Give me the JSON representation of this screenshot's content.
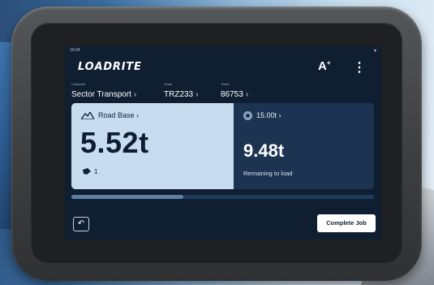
{
  "status_bar": {
    "time": "10:24"
  },
  "app_bar": {
    "logo_text": "LOADRITE",
    "font_size_label": "A",
    "font_size_sup": "+",
    "menu_glyph": "⋮"
  },
  "breadcrumbs": [
    {
      "label": "Customer",
      "value": "Sector Transport"
    },
    {
      "label": "Truck",
      "value": "TRZ233"
    },
    {
      "label": "Ticket",
      "value": "86753"
    }
  ],
  "material": {
    "name": "Road Base",
    "weight": "5.52t",
    "bucket_count": "1"
  },
  "target": {
    "value": "15.00t",
    "remaining": "9.48t",
    "remaining_label": "Remaining to load"
  },
  "progress": {
    "fraction": 0.37
  },
  "bottom_bar": {
    "complete_label": "Complete Job"
  },
  "colors": {
    "screen_bg": "#0f1e31",
    "material_panel": "#c8dcf0",
    "target_panel": "#1c3452"
  }
}
